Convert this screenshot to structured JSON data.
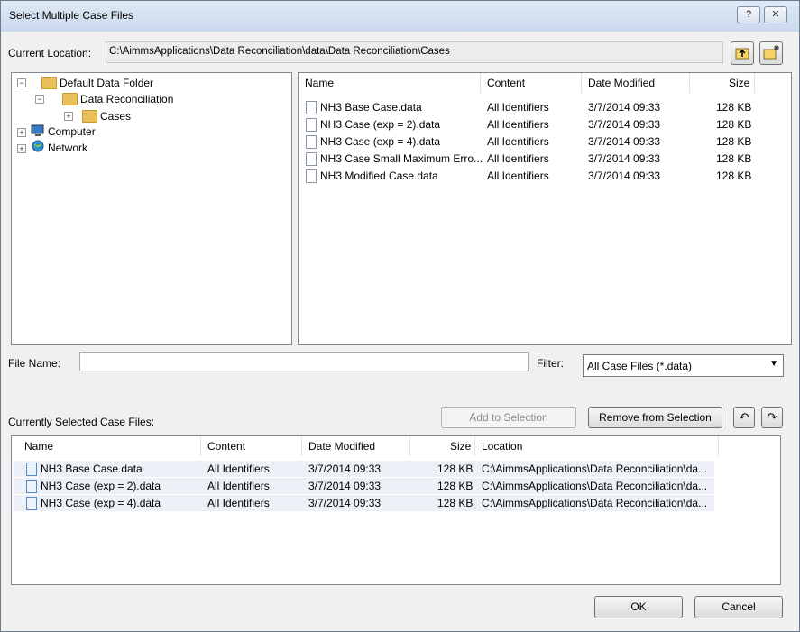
{
  "title": "Select Multiple Case Files",
  "title_buttons": {
    "help": "?",
    "close": "✕"
  },
  "location": {
    "label": "Current Location:",
    "path": "C:\\AimmsApplications\\Data Reconciliation\\data\\Data Reconciliation\\Cases"
  },
  "tree": [
    {
      "label": "Default Data Folder"
    },
    {
      "label": "Data Reconciliation"
    },
    {
      "label": "Cases"
    },
    {
      "label": "Computer"
    },
    {
      "label": "Network"
    }
  ],
  "file_list": {
    "headers": [
      "Name",
      "Content",
      "Date Modified",
      "Size"
    ],
    "rows": [
      {
        "name": "NH3 Base Case.data",
        "content": "All Identifiers",
        "date": "3/7/2014 09:33",
        "size": "128 KB"
      },
      {
        "name": "NH3 Case (exp = 2).data",
        "content": "All Identifiers",
        "date": "3/7/2014 09:33",
        "size": "128 KB"
      },
      {
        "name": "NH3 Case (exp = 4).data",
        "content": "All Identifiers",
        "date": "3/7/2014 09:33",
        "size": "128 KB"
      },
      {
        "name": "NH3 Case Small Maximum Erro...",
        "content": "All Identifiers",
        "date": "3/7/2014 09:33",
        "size": "128 KB"
      },
      {
        "name": "NH3 Modified Case.data",
        "content": "All Identifiers",
        "date": "3/7/2014 09:33",
        "size": "128 KB"
      }
    ]
  },
  "file_name": {
    "label": "File Name:",
    "value": ""
  },
  "filter": {
    "label": "Filter:",
    "selected": "All Case Files (*.data)"
  },
  "selected_section": {
    "label": "Currently Selected Case Files:",
    "add_button": "Add to Selection",
    "remove_button": "Remove from Selection"
  },
  "selected_list": {
    "headers": [
      "Name",
      "Content",
      "Date Modified",
      "Size",
      "Location"
    ],
    "rows": [
      {
        "name": "NH3 Base Case.data",
        "content": "All Identifiers",
        "date": "3/7/2014 09:33",
        "size": "128 KB",
        "location": "C:\\AimmsApplications\\Data Reconciliation\\da..."
      },
      {
        "name": "NH3 Case (exp = 2).data",
        "content": "All Identifiers",
        "date": "3/7/2014 09:33",
        "size": "128 KB",
        "location": "C:\\AimmsApplications\\Data Reconciliation\\da..."
      },
      {
        "name": "NH3 Case (exp = 4).data",
        "content": "All Identifiers",
        "date": "3/7/2014 09:33",
        "size": "128 KB",
        "location": "C:\\AimmsApplications\\Data Reconciliation\\da..."
      }
    ]
  },
  "footer": {
    "ok": "OK",
    "cancel": "Cancel"
  }
}
